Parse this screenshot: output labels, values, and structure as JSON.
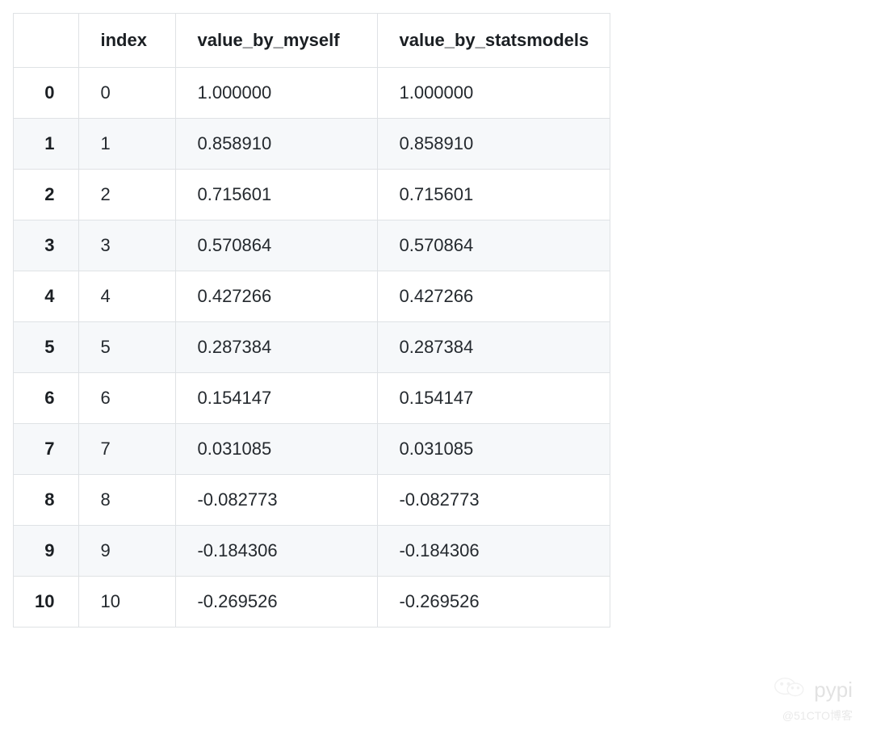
{
  "table": {
    "headers": {
      "row_index": "",
      "index": "index",
      "value_by_myself": "value_by_myself",
      "value_by_statsmodels": "value_by_statsmodels"
    },
    "rows": [
      {
        "n": "0",
        "index": "0",
        "myself": "1.000000",
        "stats": "1.000000"
      },
      {
        "n": "1",
        "index": "1",
        "myself": "0.858910",
        "stats": "0.858910"
      },
      {
        "n": "2",
        "index": "2",
        "myself": "0.715601",
        "stats": "0.715601"
      },
      {
        "n": "3",
        "index": "3",
        "myself": "0.570864",
        "stats": "0.570864"
      },
      {
        "n": "4",
        "index": "4",
        "myself": "0.427266",
        "stats": "0.427266"
      },
      {
        "n": "5",
        "index": "5",
        "myself": "0.287384",
        "stats": "0.287384"
      },
      {
        "n": "6",
        "index": "6",
        "myself": "0.154147",
        "stats": "0.154147"
      },
      {
        "n": "7",
        "index": "7",
        "myself": "0.031085",
        "stats": "0.031085"
      },
      {
        "n": "8",
        "index": "8",
        "myself": "-0.082773",
        "stats": "-0.082773"
      },
      {
        "n": "9",
        "index": "9",
        "myself": "-0.184306",
        "stats": "-0.184306"
      },
      {
        "n": "10",
        "index": "10",
        "myself": "-0.269526",
        "stats": "-0.269526"
      }
    ]
  },
  "watermark": {
    "label": "pypi",
    "sub": "@51CTO博客"
  }
}
